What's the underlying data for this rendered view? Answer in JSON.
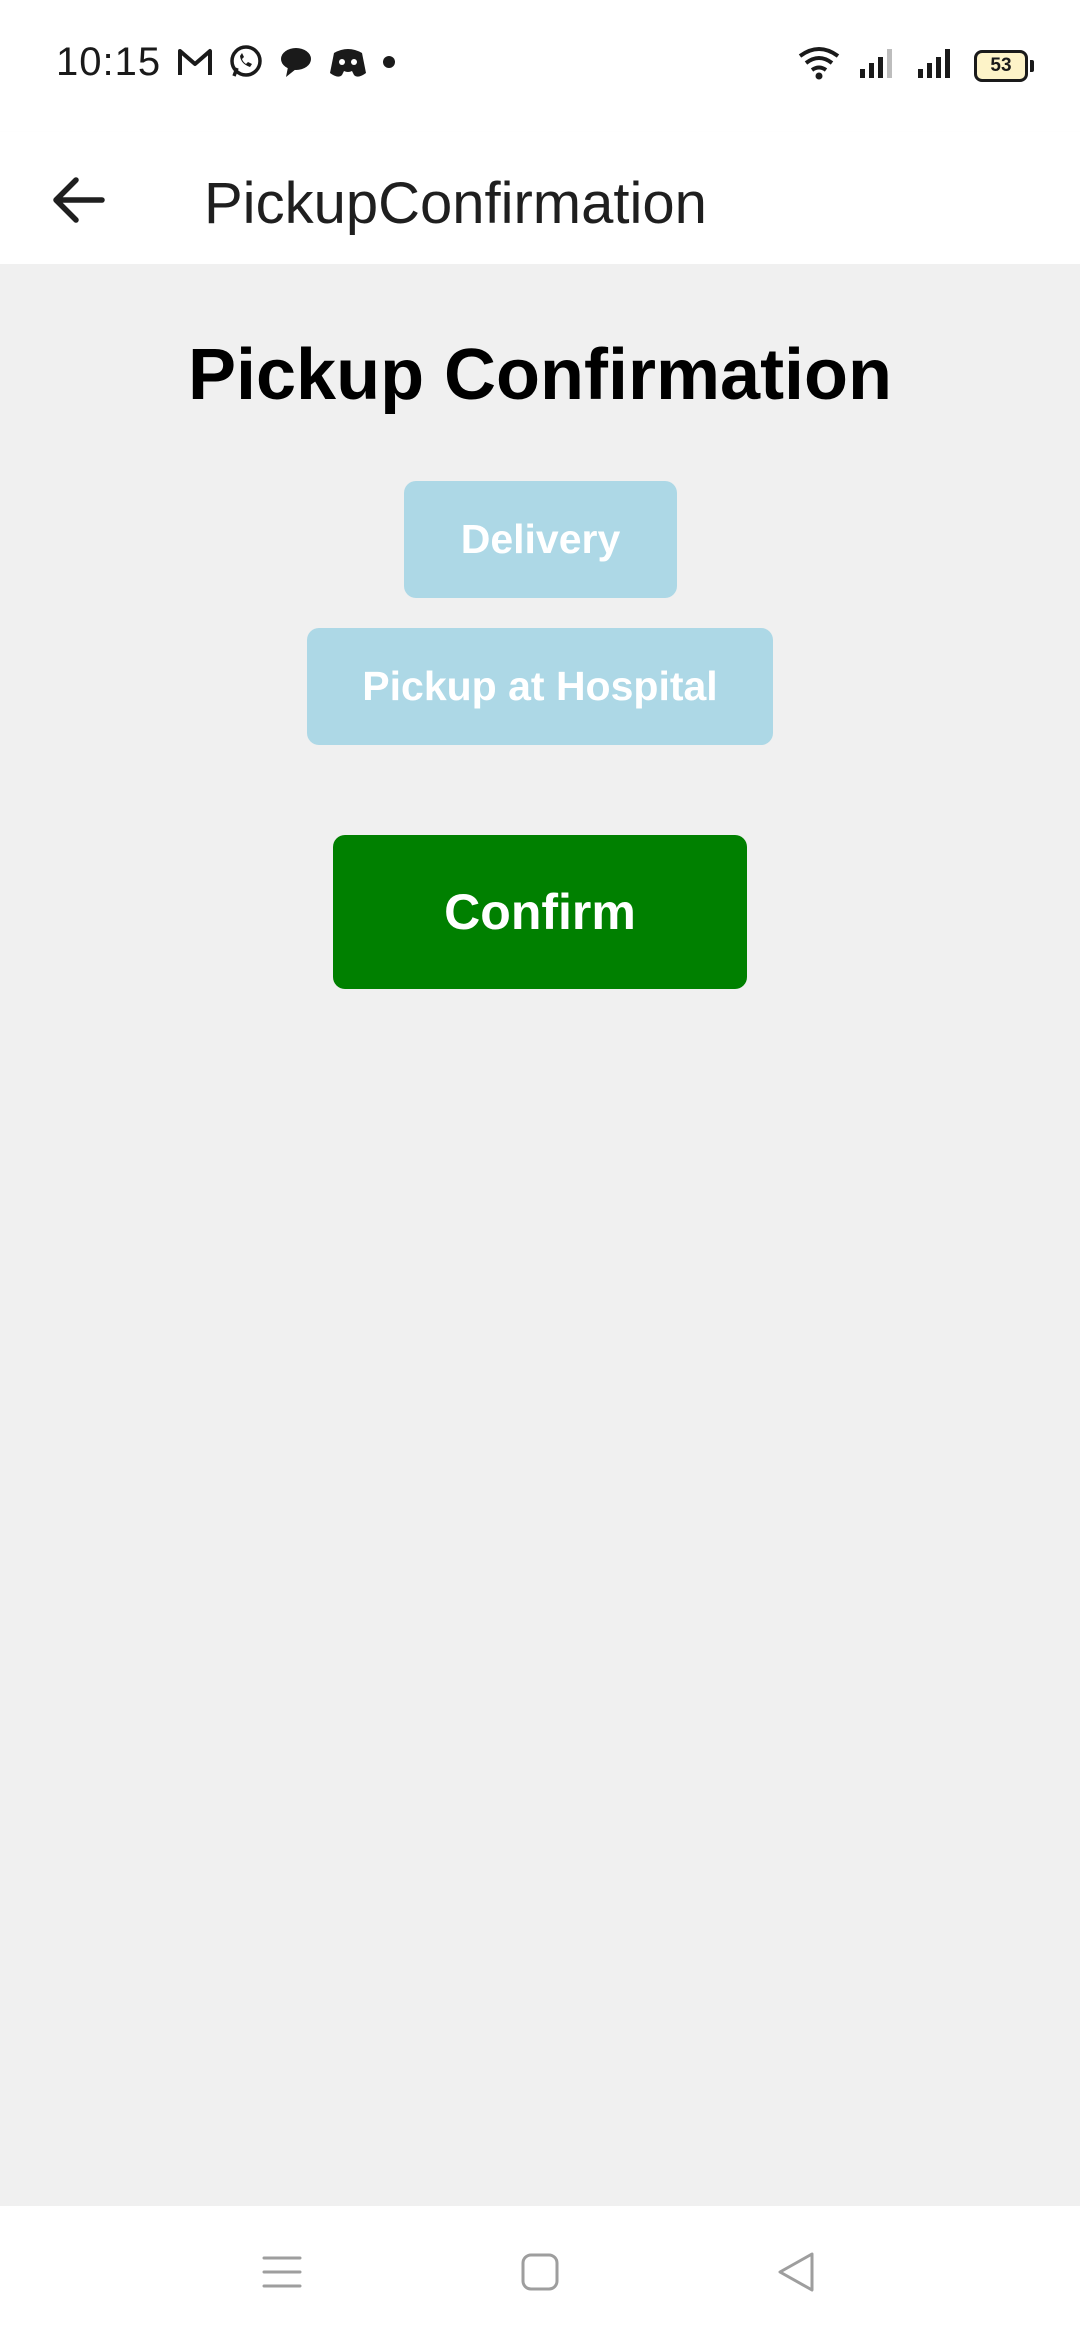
{
  "status_bar": {
    "time": "10:15",
    "notification_icons": [
      "gmail-icon",
      "whatsapp-icon",
      "chat-bubble-icon",
      "discord-icon",
      "more-dot-icon"
    ],
    "system_icons": [
      "wifi-icon",
      "signal-icon",
      "signal-icon"
    ],
    "battery_level": "53"
  },
  "app_bar": {
    "back_icon": "arrow-left-icon",
    "title": "PickupConfirmation"
  },
  "main": {
    "heading": "Pickup Confirmation",
    "options": {
      "delivery_label": "Delivery",
      "pickup_label": "Pickup at Hospital"
    },
    "confirm_label": "Confirm"
  },
  "nav_bar": {
    "icons": [
      "menu-icon",
      "home-square-icon",
      "back-triangle-icon"
    ]
  },
  "colors": {
    "background": "#f0f0f0",
    "option_button": "#add8e6",
    "confirm_button": "#008000",
    "text_on_button": "#ffffff"
  }
}
